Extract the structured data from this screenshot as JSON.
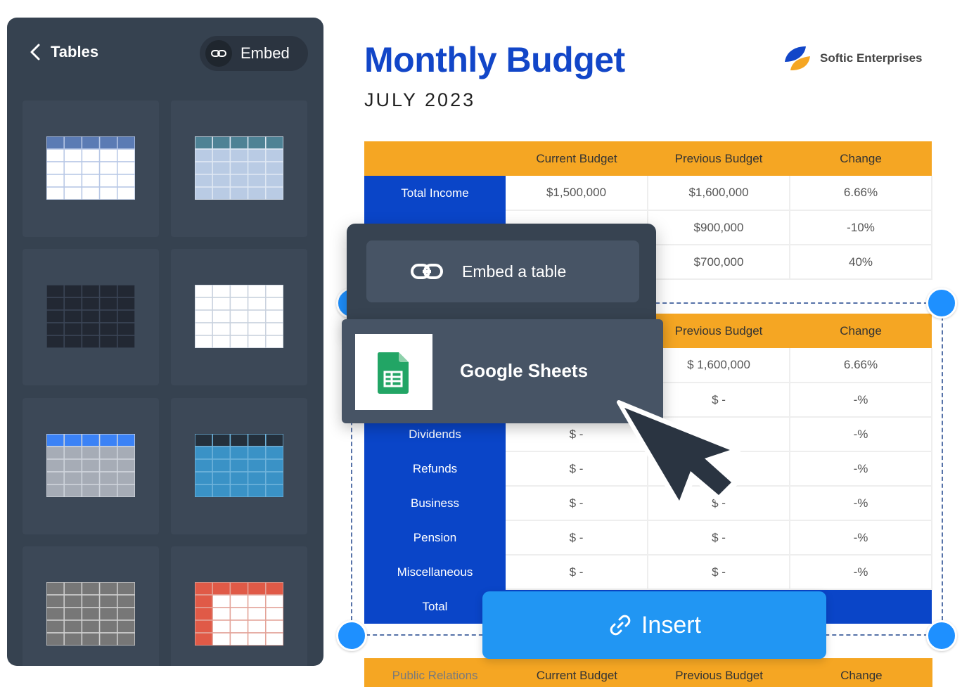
{
  "sidebar": {
    "back_label": "Tables",
    "embed_label": "Embed",
    "templates": [
      {
        "header": "#5b7bb4",
        "body": "#ffffff",
        "border": "#b8c8e6"
      },
      {
        "header": "#4e8295",
        "body": "#b9cbe4",
        "border": "#dfe8f3"
      },
      {
        "header": "#222833",
        "body": "#222833",
        "border": "#3b4556"
      },
      {
        "header": "#ffffff",
        "body": "#ffffff",
        "border": "#c9d2de"
      },
      {
        "header": "#3b82f6",
        "body": "#a6acb6",
        "border": "#cfd4dc"
      },
      {
        "header": "#24303c",
        "body": "#3a92c6",
        "border": "#6fb3db"
      },
      {
        "header": "#777777",
        "body": "#777777",
        "border": "#cfcfcf"
      },
      {
        "header": "#e05a47",
        "body": "#ffffff",
        "border": "#e3a398"
      }
    ]
  },
  "document": {
    "title": "Monthly Budget",
    "subtitle": "JULY 2023",
    "brand": "Softic Enterprises"
  },
  "table1": {
    "headers": [
      "",
      "Current Budget",
      "Previous Budget",
      "Change"
    ],
    "rows": [
      {
        "label": "Total Income",
        "current": "$1,500,000",
        "previous": "$1,600,000",
        "change": "6.66%"
      },
      {
        "label": "",
        "current": "",
        "previous": "$900,000",
        "change": "-10%"
      },
      {
        "label": "",
        "current": "",
        "previous": "$700,000",
        "change": "40%"
      }
    ]
  },
  "table2": {
    "headers": [
      "",
      "",
      "Previous Budget",
      "Change"
    ],
    "rows": [
      {
        "label": "",
        "current": "",
        "previous": "$ 1,600,000",
        "change": "6.66%"
      },
      {
        "label": "",
        "current": "",
        "previous": "$ -",
        "change": "-%"
      },
      {
        "label": "Dividends",
        "current": "$ -",
        "previous": "",
        "change": "-%"
      },
      {
        "label": "Refunds",
        "current": "$ -",
        "previous": "",
        "change": "-%"
      },
      {
        "label": "Business",
        "current": "$ -",
        "previous": "$ -",
        "change": "-%"
      },
      {
        "label": "Pension",
        "current": "$ -",
        "previous": "$ -",
        "change": "-%"
      },
      {
        "label": "Miscellaneous",
        "current": "$ -",
        "previous": "$ -",
        "change": "-%"
      }
    ],
    "total_label": "Total"
  },
  "table3": {
    "headers": [
      "Public Relations",
      "Current Budget",
      "Previous Budget",
      "Change"
    ]
  },
  "menu": {
    "embed_label": "Embed a table",
    "google_sheets_label": "Google Sheets"
  },
  "insert_label": "Insert",
  "colors": {
    "accent": "#2196f3",
    "title_blue": "#1246c8",
    "header_orange": "#f5a623",
    "rowhead_blue": "#0a45c8"
  }
}
